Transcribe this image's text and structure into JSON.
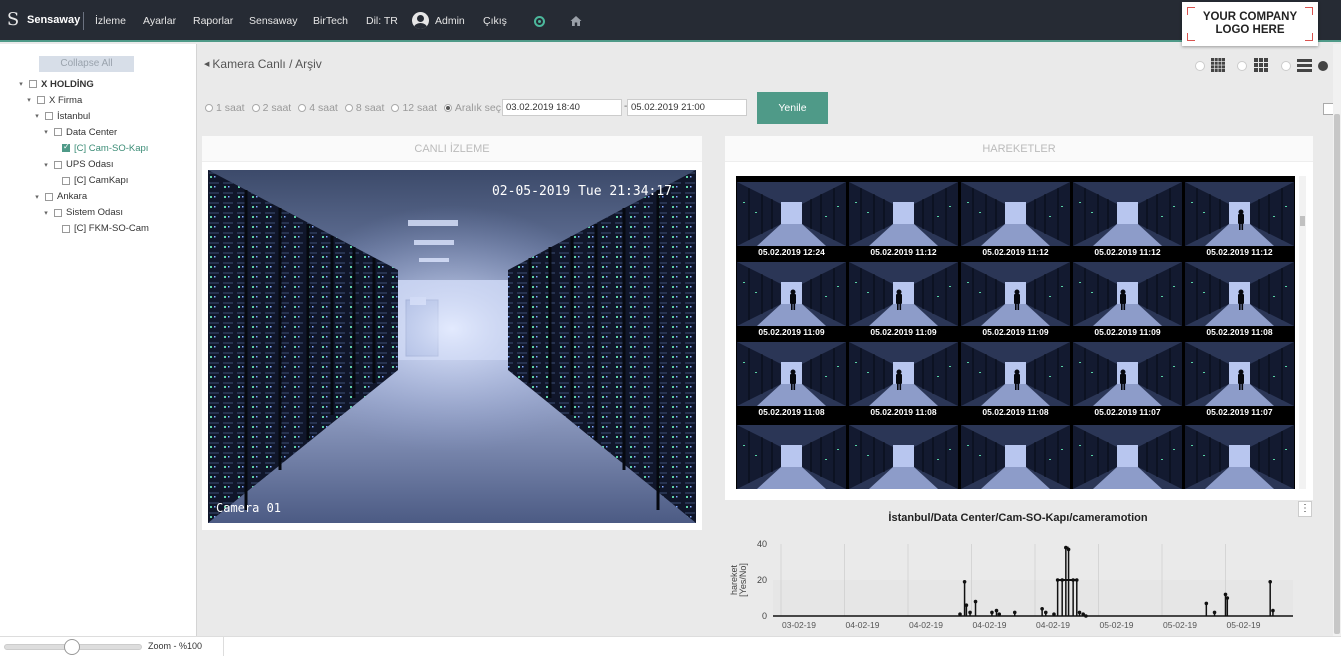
{
  "app": {
    "brand": "Sensaway",
    "brand_mark": "S"
  },
  "nav": {
    "items": [
      "İzleme",
      "Ayarlar",
      "Raporlar",
      "Sensaway",
      "BirTech",
      "Dil: TR"
    ],
    "user": "Admin",
    "logout": "Çıkış"
  },
  "logo": {
    "text": "YOUR COMPANY\nLOGO HERE"
  },
  "sidebar": {
    "collapse_label": "Collapse All",
    "tree": [
      {
        "label": "X HOLDİNG",
        "level": 0,
        "expanded": true,
        "checked": false,
        "bold": true,
        "selected": false
      },
      {
        "label": "X Firma",
        "level": 1,
        "expanded": true,
        "checked": false,
        "bold": false,
        "selected": false
      },
      {
        "label": "İstanbul",
        "level": 2,
        "expanded": true,
        "checked": false,
        "bold": false,
        "selected": false
      },
      {
        "label": "Data Center",
        "level": 3,
        "expanded": true,
        "checked": false,
        "bold": false,
        "selected": false
      },
      {
        "label": "[C] Cam-SO-Kapı",
        "level": 4,
        "expanded": null,
        "checked": true,
        "bold": false,
        "selected": true
      },
      {
        "label": "UPS Odası",
        "level": 3,
        "expanded": true,
        "checked": false,
        "bold": false,
        "selected": false
      },
      {
        "label": "[C] CamKapı",
        "level": 4,
        "expanded": null,
        "checked": false,
        "bold": false,
        "selected": false
      },
      {
        "label": "Ankara",
        "level": 2,
        "expanded": true,
        "checked": false,
        "bold": false,
        "selected": false
      },
      {
        "label": "Sistem Odası",
        "level": 3,
        "expanded": true,
        "checked": false,
        "bold": false,
        "selected": false
      },
      {
        "label": "[C] FKM-SO-Cam",
        "level": 4,
        "expanded": null,
        "checked": false,
        "bold": false,
        "selected": false
      }
    ]
  },
  "breadcrumb": "Kamera Canlı / Arşiv",
  "view_modes": [
    "grid-large",
    "grid-small",
    "list"
  ],
  "filter": {
    "options": [
      "1 saat",
      "2 saat",
      "4 saat",
      "8 saat",
      "12 saat",
      "Aralık seç"
    ],
    "selected": "Aralık seç",
    "start": "03.02.2019 18:40",
    "end": "05.02.2019 21:00",
    "range_sep": "-",
    "refresh_label": "Yenile"
  },
  "live_panel": {
    "title": "CANLI İZLEME",
    "timestamp": "02-05-2019 Tue 21:34:17",
    "camera_name": "Camera 01"
  },
  "motion_panel": {
    "title": "HAREKETLER",
    "thumbnails": [
      "05.02.2019 12:24",
      "05.02.2019 11:12",
      "05.02.2019 11:12",
      "05.02.2019 11:12",
      "05.02.2019 11:12",
      "05.02.2019 11:09",
      "05.02.2019 11:09",
      "05.02.2019 11:09",
      "05.02.2019 11:09",
      "05.02.2019 11:08",
      "05.02.2019 11:08",
      "05.02.2019 11:08",
      "05.02.2019 11:08",
      "05.02.2019 11:07",
      "05.02.2019 11:07",
      "",
      "",
      "",
      "",
      ""
    ],
    "person_visible": [
      false,
      false,
      false,
      false,
      true,
      true,
      true,
      true,
      true,
      true,
      true,
      true,
      true,
      true,
      true,
      false,
      false,
      false,
      false,
      false
    ]
  },
  "chart_data": {
    "type": "line",
    "title": "İstanbul/Data Center/Cam-SO-Kapı/cameramotion",
    "ylabel": "hareket\n[Yes/No]",
    "xlabel": "",
    "ylim": [
      0,
      40
    ],
    "yticks": [
      0,
      20,
      40
    ],
    "xticks": [
      "03-02-19",
      "04-02-19",
      "04-02-19",
      "04-02-19",
      "04-02-19",
      "05-02-19",
      "05-02-19",
      "05-02-19"
    ],
    "band": [
      0,
      20
    ],
    "series": [
      {
        "points": [
          [
            20.5,
            1
          ],
          [
            21.0,
            19
          ],
          [
            21.2,
            6
          ],
          [
            21.6,
            2
          ],
          [
            22.2,
            8
          ],
          [
            24.0,
            2
          ],
          [
            24.5,
            3
          ],
          [
            24.8,
            1
          ],
          [
            26.5,
            2
          ],
          [
            29.5,
            4
          ],
          [
            29.9,
            2
          ],
          [
            30.8,
            1
          ],
          [
            31.2,
            20
          ],
          [
            31.7,
            20
          ],
          [
            32.1,
            38
          ],
          [
            32.4,
            37
          ],
          [
            32.9,
            20
          ],
          [
            33.3,
            20
          ],
          [
            33.6,
            2
          ],
          [
            34.0,
            1
          ],
          [
            34.3,
            0
          ],
          [
            47.5,
            7
          ],
          [
            48.4,
            2
          ],
          [
            49.6,
            12
          ],
          [
            49.8,
            10
          ],
          [
            54.5,
            19
          ],
          [
            54.8,
            3
          ]
        ]
      }
    ]
  },
  "zoom": {
    "label": "Zoom - %100",
    "value": 0.5
  },
  "colors": {
    "accent": "#4f9a88",
    "navbar": "#262b34"
  }
}
